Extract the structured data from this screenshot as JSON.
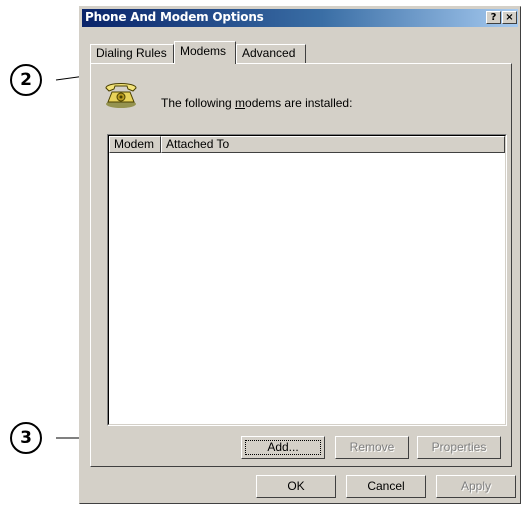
{
  "window": {
    "title": "Phone And Modem Options"
  },
  "titlebar": {
    "help_glyph": "?",
    "close_glyph": "×"
  },
  "tabs": [
    {
      "label": "Dialing Rules"
    },
    {
      "label": "Modems"
    },
    {
      "label": "Advanced"
    }
  ],
  "modems_panel": {
    "intro_prefix": "The following ",
    "intro_mnemonic": "m",
    "intro_rest": "odems are  installed:",
    "columns": [
      "Modem",
      "Attached To"
    ],
    "rows": [],
    "add_label": "Add...",
    "remove_label": "Remove",
    "properties_label": "Properties"
  },
  "footer": {
    "ok_label": "OK",
    "cancel_label": "Cancel",
    "apply_label": "Apply"
  },
  "callouts": [
    "2",
    "3"
  ]
}
